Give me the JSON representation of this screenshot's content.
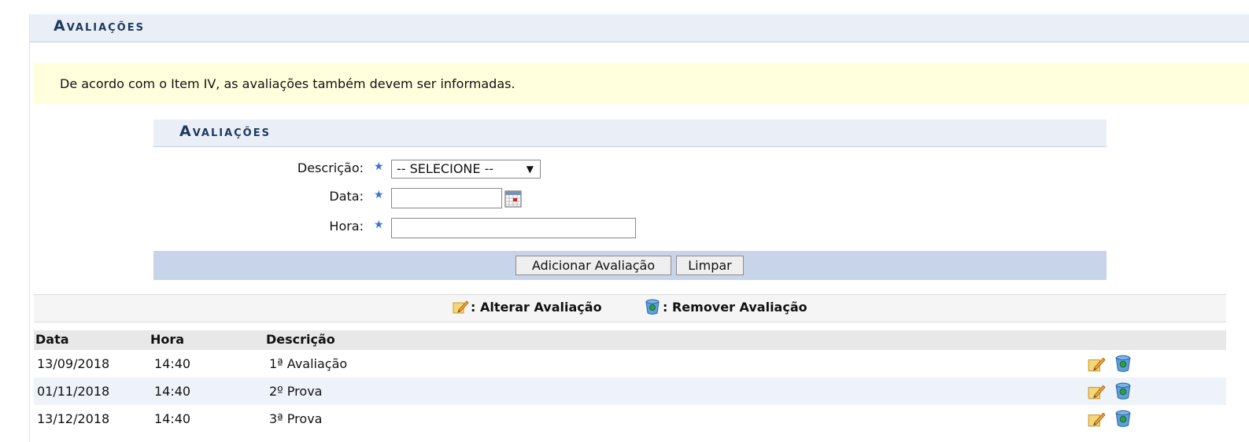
{
  "section": {
    "title": "Avaliações"
  },
  "notice": {
    "text": "De acordo com o Item IV, as avaliações também devem ser informadas."
  },
  "form": {
    "title": "Avaliações",
    "descricao_label": "Descrição:",
    "descricao_selected": "-- SELECIONE --",
    "data_label": "Data:",
    "data_value": "",
    "hora_label": "Hora:",
    "hora_value": "",
    "required_mark": "★",
    "add_button": "Adicionar Avaliação",
    "clear_button": "Limpar"
  },
  "legend": {
    "edit": ": Alterar Avaliação",
    "remove": ": Remover Avaliação"
  },
  "table": {
    "headers": [
      "Data",
      "Hora",
      "Descrição"
    ],
    "rows": [
      {
        "data": "13/09/2018",
        "hora": "14:40",
        "descricao": "1ª Avaliação"
      },
      {
        "data": "01/11/2018",
        "hora": "14:40",
        "descricao": "2º Prova"
      },
      {
        "data": "13/12/2018",
        "hora": "14:40",
        "descricao": "3ª Prova"
      }
    ]
  },
  "icons": {
    "edit": "edit-pencil-icon",
    "remove": "trash-bin-icon",
    "calendar": "calendar-icon",
    "required": "required-star-icon"
  },
  "colors": {
    "header_bg": "#eaeff7",
    "title_color": "#1e3a5e",
    "notice_bg": "#ffffdd",
    "button_bar_bg": "#c8d4ea",
    "required_star": "#3b70d4",
    "alt_row_bg": "#eef2f9"
  }
}
